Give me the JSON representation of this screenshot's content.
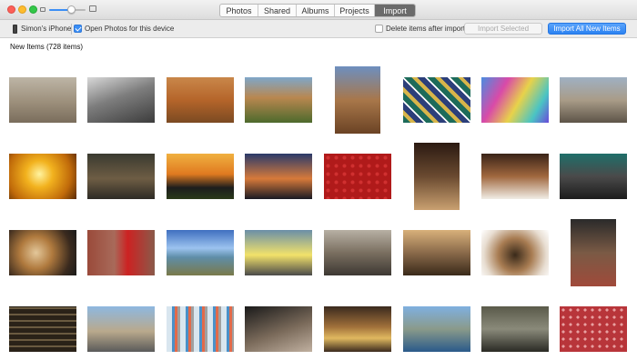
{
  "window": {
    "tabs": [
      {
        "label": "Photos",
        "active": false
      },
      {
        "label": "Shared",
        "active": false
      },
      {
        "label": "Albums",
        "active": false
      },
      {
        "label": "Projects",
        "active": false
      },
      {
        "label": "Import",
        "active": true
      }
    ],
    "zoom_level": 0.6
  },
  "toolbar": {
    "device_name": "Simon's iPhone",
    "open_photos_label": "Open Photos for this device",
    "open_photos_checked": true,
    "delete_after_import_label": "Delete items after import",
    "delete_after_import_checked": false,
    "import_selected_label": "Import Selected",
    "import_all_label": "Import All New Items",
    "accent_color": "#3b8ef5"
  },
  "main": {
    "section_title": "New Items (728 items)"
  },
  "photos": [
    {
      "name": "photo-dog-on-street",
      "orientation": "landscape"
    },
    {
      "name": "photo-bw-village",
      "orientation": "landscape"
    },
    {
      "name": "photo-courtyard-arches",
      "orientation": "landscape"
    },
    {
      "name": "photo-alhambra-gardens",
      "orientation": "landscape"
    },
    {
      "name": "photo-castle-tower",
      "orientation": "portrait"
    },
    {
      "name": "photo-moorish-tiles",
      "orientation": "landscape"
    },
    {
      "name": "photo-colorful-fabrics",
      "orientation": "landscape"
    },
    {
      "name": "photo-man-at-ruins",
      "orientation": "landscape"
    },
    {
      "name": "photo-golden-light",
      "orientation": "landscape"
    },
    {
      "name": "photo-vendor-stall",
      "orientation": "landscape"
    },
    {
      "name": "photo-sunset-field",
      "orientation": "landscape"
    },
    {
      "name": "photo-tall-ship-sunset",
      "orientation": "landscape"
    },
    {
      "name": "photo-red-door-knocker",
      "orientation": "landscape"
    },
    {
      "name": "photo-reading-man",
      "orientation": "portrait"
    },
    {
      "name": "photo-bearded-man",
      "orientation": "landscape"
    },
    {
      "name": "photo-group-of-men",
      "orientation": "landscape"
    },
    {
      "name": "photo-pastries",
      "orientation": "landscape"
    },
    {
      "name": "photo-red-phone-box",
      "orientation": "landscape"
    },
    {
      "name": "photo-coastline",
      "orientation": "landscape"
    },
    {
      "name": "photo-street-cart",
      "orientation": "landscape"
    },
    {
      "name": "photo-painter-easel",
      "orientation": "landscape"
    },
    {
      "name": "photo-harp-player",
      "orientation": "landscape"
    },
    {
      "name": "photo-spiral-stairs",
      "orientation": "landscape"
    },
    {
      "name": "photo-woman-doorway",
      "orientation": "portrait"
    },
    {
      "name": "photo-carved-letters",
      "orientation": "landscape"
    },
    {
      "name": "photo-barcelona-skyline",
      "orientation": "landscape"
    },
    {
      "name": "photo-mosaic-bench",
      "orientation": "landscape"
    },
    {
      "name": "photo-cave-steps",
      "orientation": "landscape"
    },
    {
      "name": "photo-church-nave",
      "orientation": "landscape"
    },
    {
      "name": "photo-harbor-town",
      "orientation": "landscape"
    },
    {
      "name": "photo-monk-silhouette",
      "orientation": "landscape"
    },
    {
      "name": "photo-red-studded-door",
      "orientation": "landscape"
    }
  ]
}
